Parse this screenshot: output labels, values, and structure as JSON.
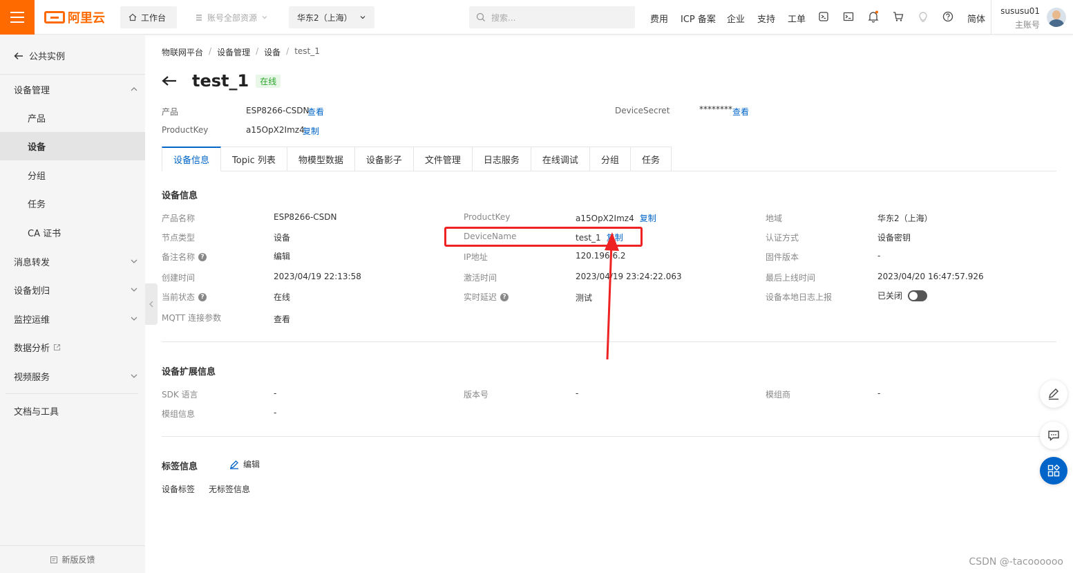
{
  "topbar": {
    "logo_text": "阿里云",
    "workbench": "工作台",
    "account_scope": "账号全部资源",
    "region": "华东2（上海）",
    "search_placeholder": "搜索...",
    "links": [
      "费用",
      "ICP 备案",
      "企业",
      "支持",
      "工单"
    ],
    "lang": "简体",
    "username": "sususu01",
    "role": "主账号",
    "brand_color": "#ff6a00"
  },
  "sidebar": {
    "back_label": "公共实例",
    "items": [
      {
        "label": "设备管理",
        "expanded": true
      },
      {
        "label": "产品"
      },
      {
        "label": "设备",
        "active": true
      },
      {
        "label": "分组"
      },
      {
        "label": "任务"
      },
      {
        "label": "CA 证书"
      },
      {
        "label": "消息转发"
      },
      {
        "label": "设备划归"
      },
      {
        "label": "监控运维"
      },
      {
        "label": "数据分析"
      },
      {
        "label": "视频服务"
      },
      {
        "label": "文档与工具"
      }
    ],
    "feedback": "新版反馈"
  },
  "breadcrumb": [
    "物联网平台",
    "设备管理",
    "设备",
    "test_1"
  ],
  "device": {
    "name": "test_1",
    "status": "在线",
    "product_label": "产品",
    "product_value": "ESP8266-CSDN",
    "product_link": "查看",
    "productkey_label": "ProductKey",
    "productkey_value": "a15OpX2Imz4",
    "productkey_link": "复制",
    "secret_label": "DeviceSecret",
    "secret_value": "********",
    "secret_link": "查看"
  },
  "tabs": [
    "设备信息",
    "Topic 列表",
    "物模型数据",
    "设备影子",
    "文件管理",
    "日志服务",
    "在线调试",
    "分组",
    "任务"
  ],
  "device_info": {
    "title": "设备信息",
    "product_name_label": "产品名称",
    "product_name": "ESP8266-CSDN",
    "node_type_label": "节点类型",
    "node_type": "设备",
    "remark_label": "备注名称",
    "remark_action": "编辑",
    "created_label": "创建时间",
    "created": "2023/04/19 22:13:58",
    "state_label": "当前状态",
    "state": "在线",
    "mqtt_label": "MQTT 连接参数",
    "mqtt_action": "查看",
    "productkey_label": "ProductKey",
    "productkey": "a15OpX2Imz4",
    "copy": "复制",
    "devicename_label": "DeviceName",
    "devicename": "test_1",
    "ip_label": "IP地址",
    "ip": "120.196.6.2",
    "activated_label": "激活时间",
    "activated": "2023/04/19 23:24:22.063",
    "latency_label": "实时延迟",
    "latency_action": "测试",
    "region_label": "地域",
    "region": "华东2（上海）",
    "auth_label": "认证方式",
    "auth": "设备密钥",
    "firmware_label": "固件版本",
    "firmware": "-",
    "last_online_label": "最后上线时间",
    "last_online": "2023/04/20 16:47:57.926",
    "local_log_label": "设备本地日志上报",
    "local_log": "已关闭"
  },
  "ext_info": {
    "title": "设备扩展信息",
    "sdk_label": "SDK 语言",
    "sdk": "-",
    "version_label": "版本号",
    "version": "-",
    "vendor_label": "模组商",
    "vendor": "-",
    "module_label": "模组信息",
    "module": "-"
  },
  "tag_info": {
    "title": "标签信息",
    "edit": "编辑",
    "label": "设备标签",
    "value": "无标签信息"
  },
  "watermark": "CSDN @-tacoooooo"
}
